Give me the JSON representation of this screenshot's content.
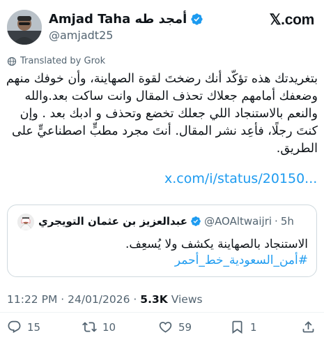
{
  "site": {
    "logo_text": "𝕏.com"
  },
  "author": {
    "display_name": "Amjad Taha أمجد طه",
    "handle": "@amjadt25"
  },
  "translation": {
    "label": "Translated by Grok"
  },
  "tweet": {
    "text": "بتغريدتك هذه تؤكّد أنك رضختَ لقوة الصهاينة، وأن خوفك منهم وضعفك أمامهم جعلاك تحذف المقال وانت ساكت بعد.والله والنعم بالاستنجاد اللي جعلك تخضع وتحذف و ادبك بعد . وإن كنتَ رجلًا، فأعِد نشر المقال. أنتَ مجرد مطبٍّ اصطناعيٍّ على الطريق.",
    "link": "x.com/i/status/20150..."
  },
  "quoted": {
    "display_name": "عبدالعزيز بن عثمان التويجري",
    "handle": "@AOAltwaijri",
    "separator": "·",
    "time": "5h",
    "text_line": "الاستنجاد بالصهاينة يكشف ولا يُسعِف.",
    "hashtag": "#أمن_السعودية_خط_أحمر"
  },
  "meta": {
    "time": "11:22 PM",
    "separator": "·",
    "date": "24/01/2026",
    "views_count": "5.3K",
    "views_label": "Views"
  },
  "actions": {
    "replies": "15",
    "reposts": "10",
    "likes": "59",
    "bookmarks": "1"
  },
  "colors": {
    "link": "#1d9bf0",
    "secondary": "#536471",
    "border": "#cfd9de",
    "verified": "#1d9bf0"
  }
}
